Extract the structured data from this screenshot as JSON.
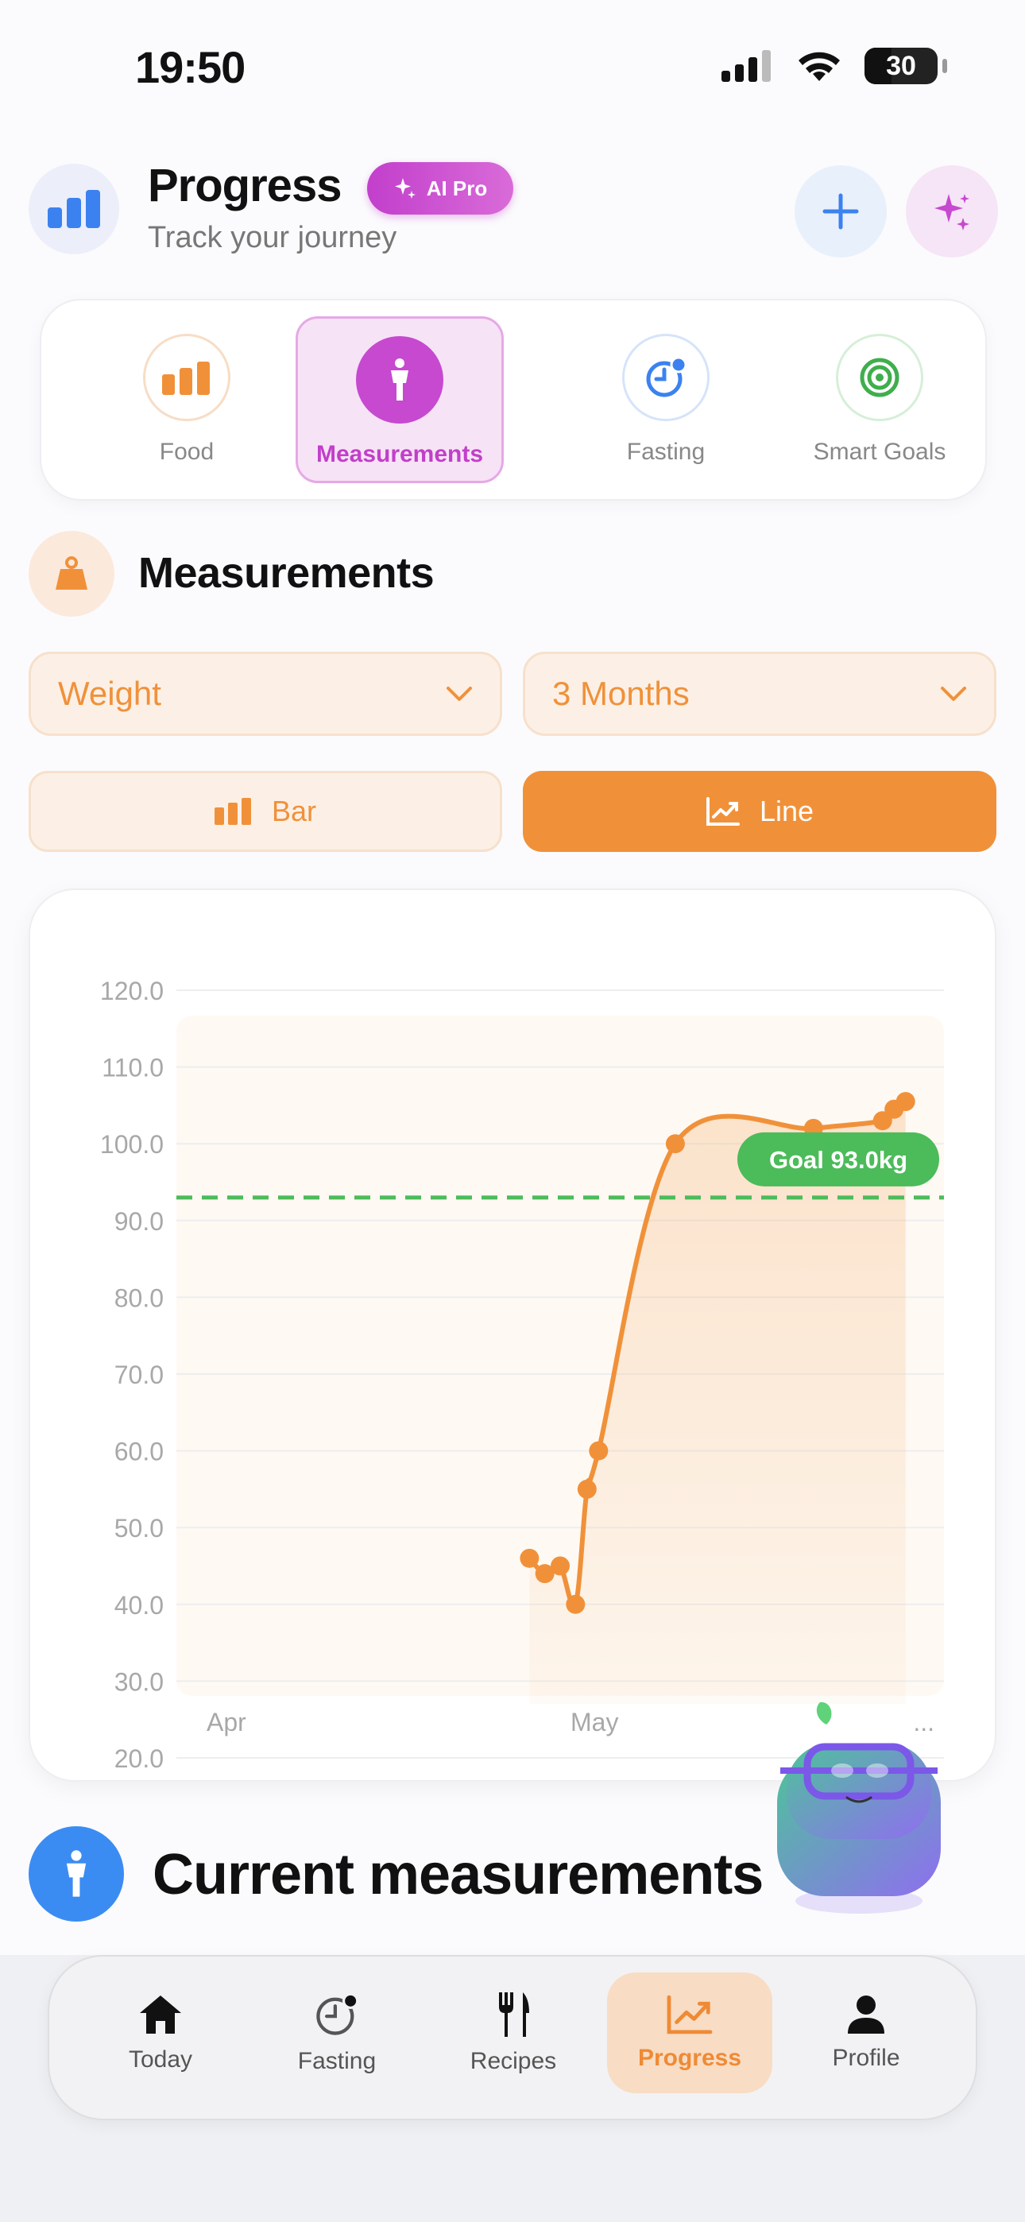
{
  "status": {
    "time": "19:50",
    "battery": "30"
  },
  "header": {
    "title": "Progress",
    "subtitle": "Track your journey",
    "badge": "AI Pro"
  },
  "tabs": [
    {
      "label": "Food"
    },
    {
      "label": "Measurements",
      "active": true
    },
    {
      "label": "Fasting"
    },
    {
      "label": "Smart Goals"
    }
  ],
  "section": {
    "title": "Measurements"
  },
  "filters": {
    "metric": "Weight",
    "range": "3 Months"
  },
  "chart_toggle": {
    "bar": "Bar",
    "line": "Line",
    "selected": "Line"
  },
  "chart_data": {
    "type": "line",
    "yticks": [
      "120.0",
      "110.0",
      "100.0",
      "90.0",
      "80.0",
      "70.0",
      "60.0",
      "50.0",
      "40.0",
      "30.0",
      "20.0"
    ],
    "ylim": [
      20,
      120
    ],
    "xticks": [
      "Apr",
      "May",
      "..."
    ],
    "goal": {
      "value": 93.0,
      "label": "Goal 93.0kg"
    },
    "points": [
      {
        "t": 0.46,
        "y": 46
      },
      {
        "t": 0.48,
        "y": 44
      },
      {
        "t": 0.5,
        "y": 45
      },
      {
        "t": 0.52,
        "y": 40
      },
      {
        "t": 0.535,
        "y": 55
      },
      {
        "t": 0.55,
        "y": 60
      },
      {
        "t": 0.65,
        "y": 100
      },
      {
        "t": 0.83,
        "y": 102
      },
      {
        "t": 0.92,
        "y": 103
      },
      {
        "t": 0.935,
        "y": 104.5
      },
      {
        "t": 0.95,
        "y": 105.5
      }
    ],
    "colors": {
      "line": "#f0913a",
      "goal": "#4cbb5a"
    }
  },
  "current": {
    "title": "Current measurements"
  },
  "nav": [
    {
      "label": "Today"
    },
    {
      "label": "Fasting"
    },
    {
      "label": "Recipes"
    },
    {
      "label": "Progress",
      "active": true
    },
    {
      "label": "Profile"
    }
  ]
}
